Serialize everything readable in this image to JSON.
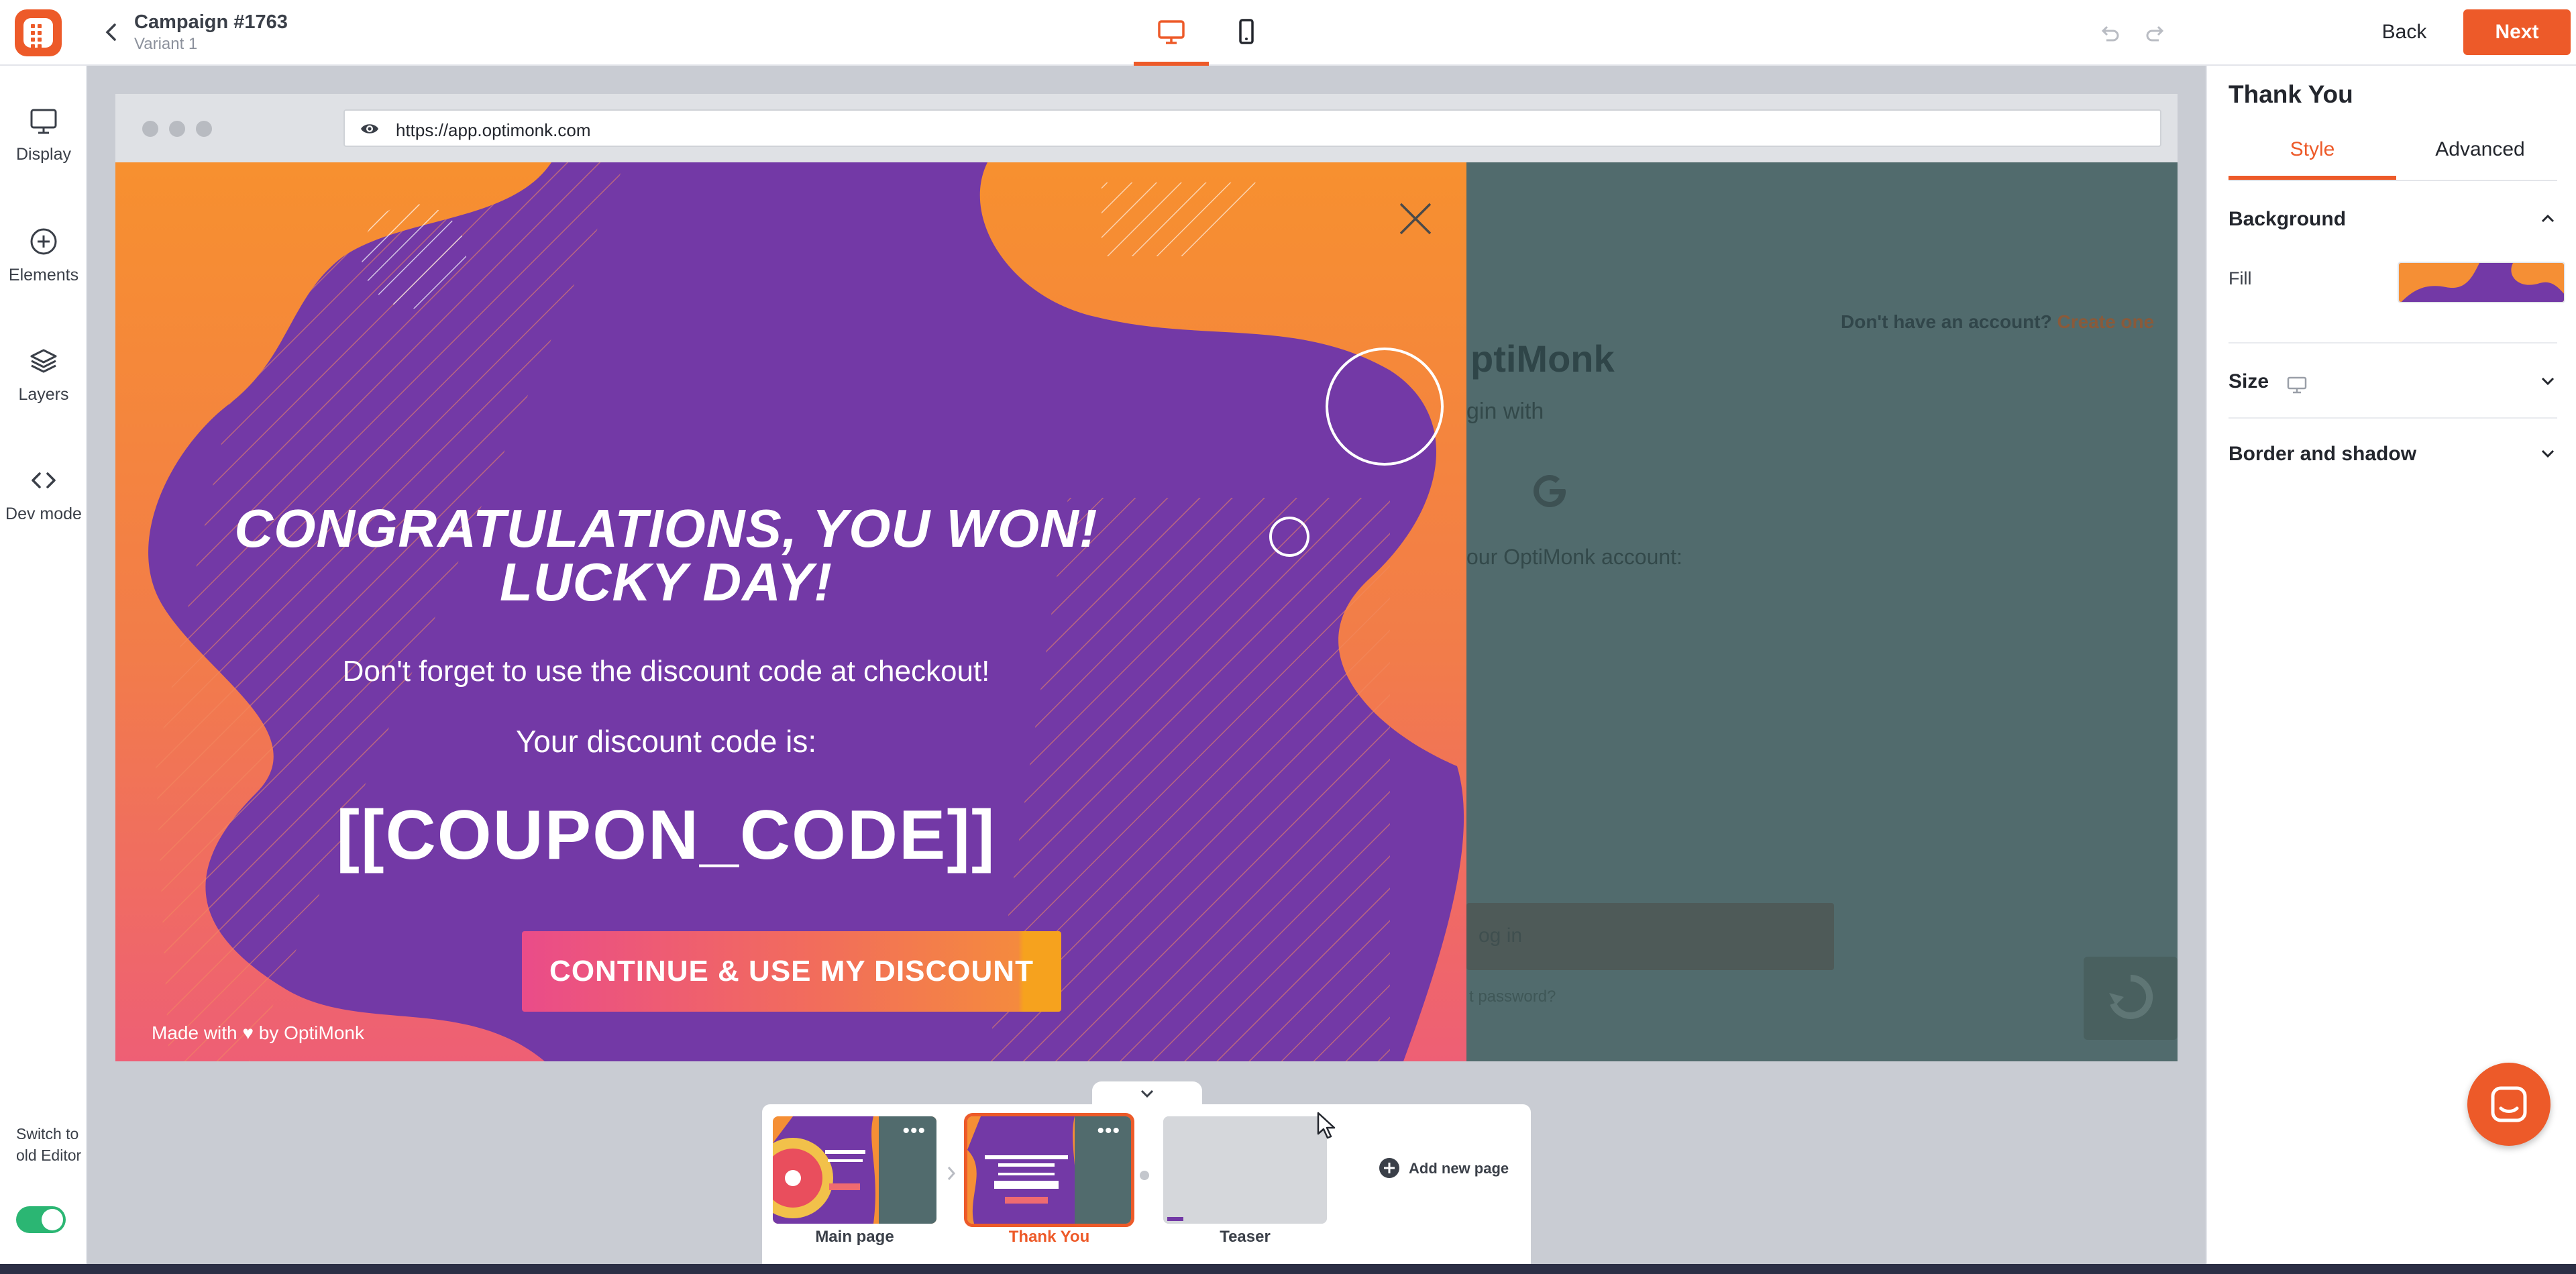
{
  "header": {
    "campaign_title": "Campaign #1763",
    "variant": "Variant 1",
    "back_label": "Back",
    "next_label": "Next",
    "device_active": "desktop"
  },
  "sidebar": {
    "items": [
      {
        "label": "Display",
        "icon": "monitor-icon"
      },
      {
        "label": "Elements",
        "icon": "plus-circle-icon"
      },
      {
        "label": "Layers",
        "icon": "layers-icon"
      },
      {
        "label": "Dev mode",
        "icon": "code-icon"
      }
    ],
    "switch_label": "Switch to old Editor",
    "switch_on": true
  },
  "right_panel": {
    "title": "Thank You",
    "tabs": [
      "Style",
      "Advanced"
    ],
    "active_tab": "Style",
    "sections": {
      "background": "Background",
      "fill_label": "Fill",
      "size": "Size",
      "border": "Border and shadow"
    }
  },
  "browser": {
    "url": "https://app.optimonk.com"
  },
  "background_site": {
    "no_account": "Don't have an account?",
    "create_one": "Create one",
    "brand": "ptiMonk",
    "login_with": "gin with",
    "account_text": "our OptiMonk account:",
    "login_button": "og in",
    "forgot": "t password?"
  },
  "popup": {
    "headline_1": "CONGRATULATIONS, YOU WON!",
    "headline_2": "LUCKY DAY!",
    "reminder": "Don't forget to use the discount code at checkout!",
    "code_label": "Your discount code is:",
    "coupon": "[[COUPON_CODE]]",
    "cta": "CONTINUE & USE MY DISCOUNT",
    "made_with": "Made with ♥ by OptiMonk"
  },
  "pages": [
    {
      "label": "Main page",
      "selected": false
    },
    {
      "label": "Thank You",
      "selected": true
    },
    {
      "label": "Teaser",
      "selected": false
    }
  ],
  "add_page_label": "Add new page",
  "colors": {
    "accent": "#ed5a29",
    "purple": "#7339a6",
    "orange": "#f58f35",
    "pink": "#ef6b70",
    "site_bg": "#516b6d",
    "toggle_on": "#2bb673"
  }
}
